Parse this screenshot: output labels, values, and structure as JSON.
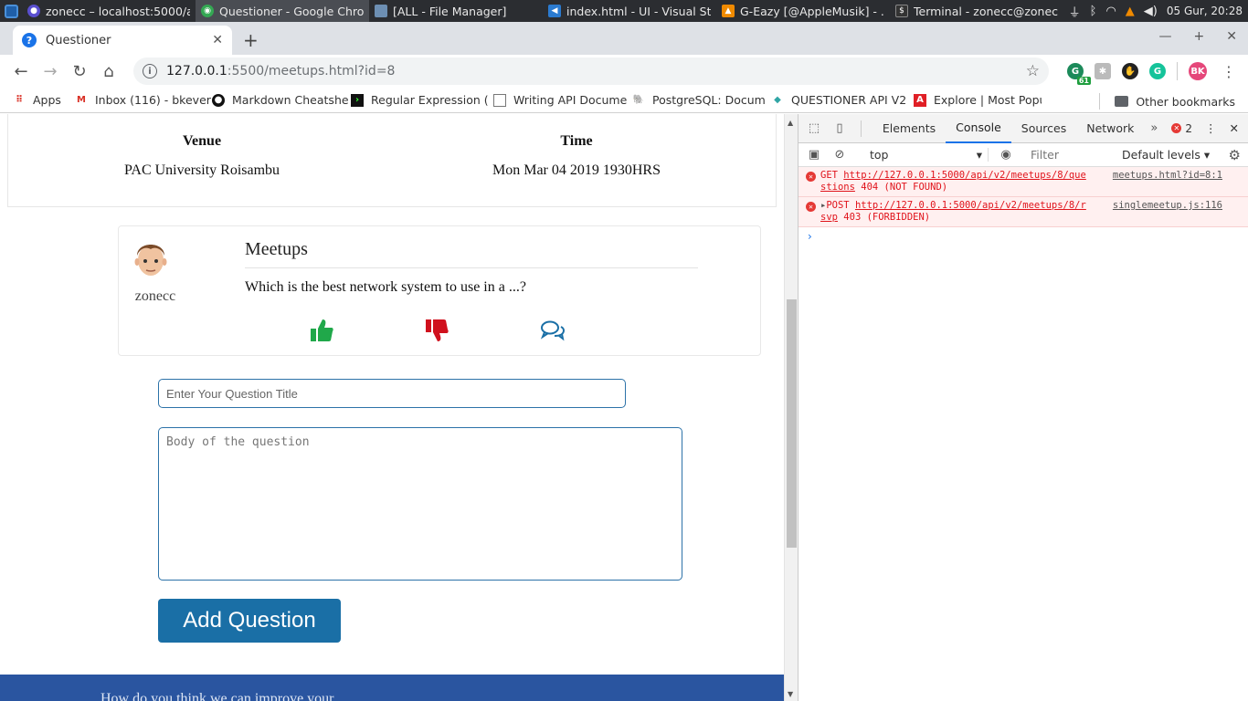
{
  "taskbar": {
    "tasks": [
      {
        "label": "zonecc – localhost:5000/a...",
        "color": "#5a4fcf"
      },
      {
        "label": "Questioner - Google Chro...",
        "color": "#34a853"
      },
      {
        "label": "[ALL - File Manager]",
        "color": "#6d8fb3"
      },
      {
        "label": "index.html - UI - Visual St...",
        "color": "#2b7bd0"
      },
      {
        "label": "G-Eazy [@AppleMusik] - ...",
        "color": "#f08a00"
      },
      {
        "label": "Terminal - zonecc@zonec...",
        "color": "#333333"
      }
    ],
    "clock": "05 Gur, 20:28"
  },
  "browser": {
    "tab_title": "Questioner",
    "url_host": "127.0.0.1",
    "url_rest": ":5500/meetups.html?id=8",
    "extension_badge": "61",
    "profile_initials": "BK",
    "bookmarks": [
      {
        "label": "Apps",
        "icon": "apps-grid-icon"
      },
      {
        "label": "Inbox (116) - bkever",
        "icon": "gmail-icon"
      },
      {
        "label": "Markdown Cheatshe",
        "icon": "github-icon"
      },
      {
        "label": "Regular Expression (",
        "icon": "terminal-icon"
      },
      {
        "label": "Writing API Docume",
        "icon": "page-icon"
      },
      {
        "label": "PostgreSQL: Docum",
        "icon": "postgres-icon"
      },
      {
        "label": "QUESTIONER API V2",
        "icon": "heroku-icon"
      },
      {
        "label": "Explore | Most Popu",
        "icon": "adobe-icon"
      }
    ],
    "other_bookmarks": "Other bookmarks"
  },
  "page": {
    "venue_label": "Venue",
    "venue_value": "PAC University Roisambu",
    "time_label": "Time",
    "time_value": "Mon Mar 04 2019 1930HRS",
    "question": {
      "username": "zonecc",
      "title": "Meetups",
      "body": "Which is the best network system to use in a ...?"
    },
    "form": {
      "title_placeholder": "Enter Your Question Title",
      "body_placeholder": "Body of the question",
      "submit_label": "Add Question"
    },
    "footer_text": "How do you think we can improve your"
  },
  "devtools": {
    "tabs": [
      "Elements",
      "Console",
      "Sources",
      "Network"
    ],
    "active_tab": "Console",
    "error_count": "2",
    "context": "top",
    "filter_placeholder": "Filter",
    "levels": "Default levels",
    "messages": [
      {
        "method": "GET",
        "url": "http://127.0.0.1:5000/api/v2/meetups/8/que",
        "url_cont": "stions",
        "status": "404 (NOT FOUND)",
        "source": "meetups.html?id=8:1"
      },
      {
        "method": "POST",
        "url": "http://127.0.0.1:5000/api/v2/meetups/8/r",
        "url_cont": "svp",
        "status": "403 (FORBIDDEN)",
        "source": "singlemeetup.js:116"
      }
    ]
  }
}
